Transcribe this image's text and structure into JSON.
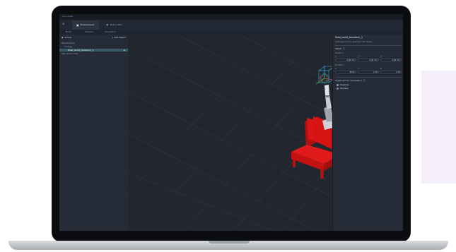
{
  "window": {
    "title": "Live Asset"
  },
  "tabs": [
    {
      "label": "Environment",
      "icon": "cube-icon",
      "active": true
    },
    {
      "label": "Motion Plan",
      "icon": "flag-icon",
      "active": false
    }
  ],
  "menu": [
    "Build",
    "Preview",
    "Simulation"
  ],
  "sidebar": {
    "title": "Scene",
    "add_label": "+ Add Object",
    "tree": [
      {
        "label": "World frame",
        "level": 0
      },
      {
        "label": "Lounge",
        "level": 1
      },
      {
        "label": "fixed_world_transform_1",
        "level": 2,
        "selected": true,
        "tag": "≡"
      },
      {
        "label": "Mini world chair",
        "level": 0
      }
    ]
  },
  "properties": {
    "title": "fixed_world_transform_1",
    "subtitle": "Settings for the selected 3D object",
    "offset_section": "Offset",
    "position_label": "Position",
    "axes": [
      "X",
      "Y",
      "Z"
    ],
    "position": [
      "0.00 mm",
      "0.00 mm",
      "0.00 mm"
    ],
    "rotation_label": "Rotation",
    "rotation": [
      "90.00",
      "0.00",
      "0.00"
    ],
    "angle_section": "Angle unit for orientation",
    "angle_options": [
      "Degrees",
      "Radians"
    ],
    "angle_selected": "Degrees"
  },
  "colors": {
    "accent": "#2f8fd6",
    "object_red": "#d91515",
    "selection": "#3a5a66"
  }
}
